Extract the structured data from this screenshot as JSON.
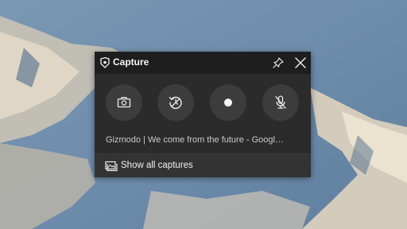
{
  "capture_widget": {
    "title": "Capture",
    "source_title": "Gizmodo | We come from the future - Googl…",
    "show_all_label": "Show all captures",
    "icons": {
      "app": "xbox-game-bar-icon",
      "pin": "pin-icon",
      "close": "close-icon",
      "screenshot": "camera-icon",
      "record_last": "history-record-icon",
      "record": "record-icon",
      "mic": "microphone-muted-icon",
      "gallery": "gallery-icon"
    }
  }
}
